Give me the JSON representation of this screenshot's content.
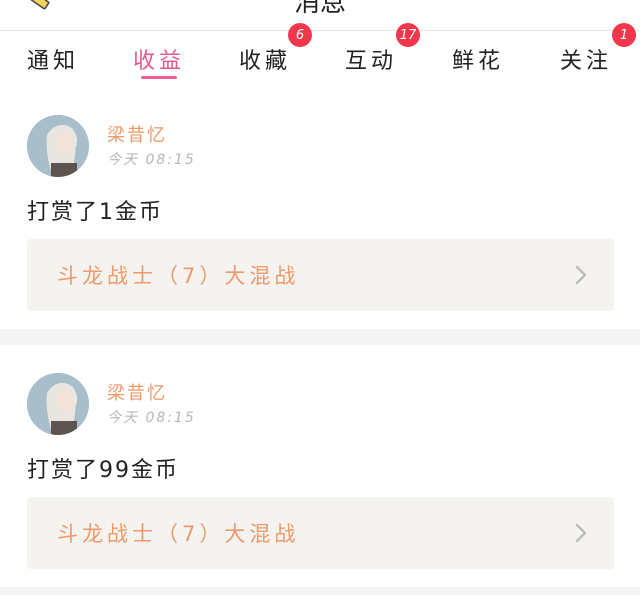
{
  "header": {
    "title": "消息"
  },
  "tabs": [
    {
      "label": "通知",
      "badge": "",
      "active": false
    },
    {
      "label": "收益",
      "badge": "",
      "active": true
    },
    {
      "label": "收藏",
      "badge": "6",
      "active": false
    },
    {
      "label": "互动",
      "badge": "17",
      "active": false
    },
    {
      "label": "鲜花",
      "badge": "",
      "active": false
    },
    {
      "label": "关注",
      "badge": "1",
      "active": false
    }
  ],
  "items": [
    {
      "user": "梁昔忆",
      "time": "今天 08:15",
      "reward": "打赏了1金币",
      "work_title": "斗龙战士（7）大混战"
    },
    {
      "user": "梁昔忆",
      "time": "今天 08:15",
      "reward": "打赏了99金币",
      "work_title": "斗龙战士（7）大混战"
    }
  ],
  "colors": {
    "accent_pink": "#ee5c94",
    "badge_red": "#f2374c",
    "name_orange": "#ee9a6a",
    "work_box_bg": "#f4f3ef"
  }
}
